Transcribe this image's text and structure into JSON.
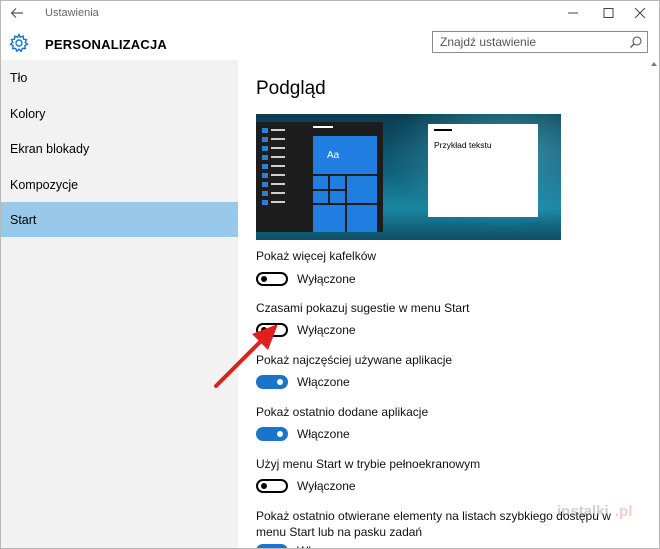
{
  "window": {
    "app_title": "Ustawienia",
    "section_title": "PERSONALIZACJA"
  },
  "search": {
    "placeholder": "Znajdź ustawienie"
  },
  "sidebar": {
    "items": [
      {
        "label": "Tło",
        "active": false
      },
      {
        "label": "Kolory",
        "active": false
      },
      {
        "label": "Ekran blokady",
        "active": false
      },
      {
        "label": "Kompozycje",
        "active": false
      },
      {
        "label": "Start",
        "active": true
      }
    ]
  },
  "main": {
    "heading": "Podgląd",
    "preview": {
      "tile_label": "Aa",
      "sample_text": "Przykład tekstu"
    },
    "settings": [
      {
        "label": "Pokaż więcej kafelków",
        "state": "Wyłączone",
        "on": false
      },
      {
        "label": "Czasami pokazuj sugestie w menu Start",
        "state": "Wyłączone",
        "on": false
      },
      {
        "label": "Pokaż najczęściej używane aplikacje",
        "state": "Włączone",
        "on": true
      },
      {
        "label": "Pokaż ostatnio dodane aplikacje",
        "state": "Włączone",
        "on": true
      },
      {
        "label": "Użyj menu Start w trybie pełnoekranowym",
        "state": "Wyłączone",
        "on": false
      },
      {
        "label": "Pokaż ostatnio otwierane elementy na listach szybkiego dostępu w",
        "label2": "menu Start lub na pasku zadań",
        "state": "Włączone",
        "on": true
      }
    ]
  },
  "watermark": {
    "part1": "instalki",
    "part2": ".pl"
  },
  "colors": {
    "accent": "#1a74c9",
    "sidebar_active": "#99c9ea",
    "sidebar_bg": "#f2f2f2",
    "annotation_arrow": "#e0201e"
  }
}
